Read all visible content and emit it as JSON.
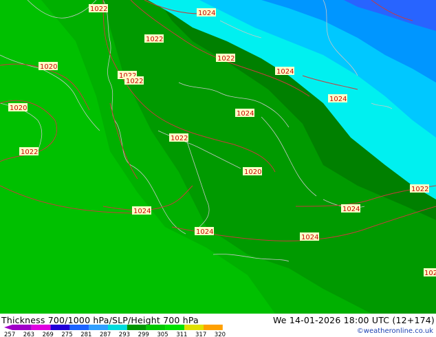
{
  "footer": {
    "title": "Thickness 700/1000 hPa/SLP/Height 700 hPa",
    "datetime": "We 14-01-2026 18:00 UTC (12+174)",
    "credit": "©weatheronline.co.uk"
  },
  "colorbar": {
    "ticks": [
      "257",
      "263",
      "269",
      "275",
      "281",
      "287",
      "293",
      "299",
      "305",
      "311",
      "317",
      "320"
    ],
    "colors": [
      "#a000c8",
      "#e000e0",
      "#2000d8",
      "#1c64ff",
      "#30a0ff",
      "#00dcdc",
      "#009600",
      "#00c800",
      "#00e000",
      "#e0e000",
      "#ffa000"
    ]
  },
  "map": {
    "pressure_labels": [
      "1022",
      "1024",
      "1022",
      "1022",
      "1024",
      "1020",
      "1022",
      "1022",
      "1024",
      "1020",
      "1024",
      "1022",
      "1022",
      "1020",
      "1022",
      "1024",
      "1024",
      "1024",
      "1024",
      "1024",
      "1024",
      "102"
    ],
    "fill_colors": {
      "green_light": "#00c800",
      "green_medium": "#00b000",
      "green_dark": "#009000",
      "green_darkest": "#007800",
      "cyan": "#00f0f0",
      "sky_blue": "#00c8ff",
      "blue": "#0096ff",
      "deep_blue": "#2864ff"
    },
    "isobar_color": "#c83c3c",
    "coast_color": "#c8c8c8"
  }
}
